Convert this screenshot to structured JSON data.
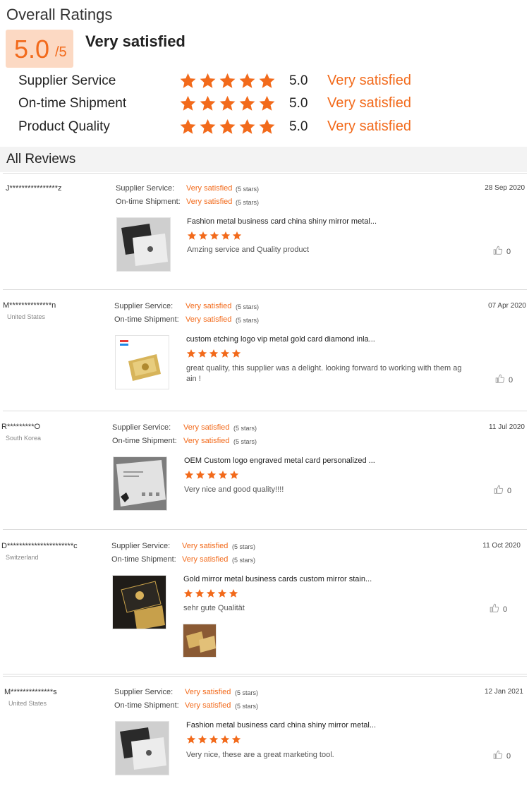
{
  "overall": {
    "title": "Overall Ratings",
    "score_big": "5.0",
    "score_suffix": "/5",
    "label": "Very satisfied",
    "accent": "#f26a1b"
  },
  "criteria": [
    {
      "label": "Supplier Service",
      "stars": 5,
      "score": "5.0",
      "verdict": "Very satisfied"
    },
    {
      "label": "On-time Shipment",
      "stars": 5,
      "score": "5.0",
      "verdict": "Very satisfied"
    },
    {
      "label": "Product Quality",
      "stars": 5,
      "score": "5.0",
      "verdict": "Very satisfied"
    }
  ],
  "all_reviews_title": "All Reviews",
  "reviews": [
    {
      "name": "J****************z",
      "country": "",
      "date": "28 Sep 2020",
      "supplier_service_label": "Supplier Service:",
      "supplier_service_value": "Very satisfied",
      "supplier_service_stars": "(5 stars)",
      "shipment_label": "On-time Shipment:",
      "shipment_value": "Very satisfied",
      "shipment_stars": "(5 stars)",
      "product_title": "Fashion metal business card china shiny mirror metal...",
      "rating": 5,
      "text": "Amzing service and Quality product",
      "likes": "0"
    },
    {
      "name": "M**************n",
      "country": "United States",
      "date": "07 Apr 2020",
      "supplier_service_label": "Supplier Service:",
      "supplier_service_value": "Very satisfied",
      "supplier_service_stars": "(5 stars)",
      "shipment_label": "On-time Shipment:",
      "shipment_value": "Very satisfied",
      "shipment_stars": "(5 stars)",
      "product_title": "custom etching logo vip metal gold card diamond inla...",
      "rating": 5,
      "text": "great quality, this supplier was a delight. looking forward to working with them ag ain !",
      "likes": "0"
    },
    {
      "name": "R*********O",
      "country": "South Korea",
      "date": "11 Jul 2020",
      "supplier_service_label": "Supplier Service:",
      "supplier_service_value": "Very satisfied",
      "supplier_service_stars": "(5 stars)",
      "shipment_label": "On-time Shipment:",
      "shipment_value": "Very satisfied",
      "shipment_stars": "(5 stars)",
      "product_title": "OEM Custom logo engraved metal card personalized ...",
      "rating": 5,
      "text": "Very nice and good quality!!!!",
      "likes": "0"
    },
    {
      "name": "D**********************c",
      "country": "Switzerland",
      "date": "11 Oct 2020",
      "supplier_service_label": "Supplier Service:",
      "supplier_service_value": "Very satisfied",
      "supplier_service_stars": "(5 stars)",
      "shipment_label": "On-time Shipment:",
      "shipment_value": "Very satisfied",
      "shipment_stars": "(5 stars)",
      "product_title": "Gold mirror metal business cards custom mirror stain...",
      "rating": 5,
      "text": "sehr gute Qualität",
      "likes": "0"
    },
    {
      "name": "M**************s",
      "country": "United States",
      "date": "12 Jan 2021",
      "supplier_service_label": "Supplier Service:",
      "supplier_service_value": "Very satisfied",
      "supplier_service_stars": "(5 stars)",
      "shipment_label": "On-time Shipment:",
      "shipment_value": "Very satisfied",
      "shipment_stars": "(5 stars)",
      "product_title": "Fashion metal business card china shiny mirror metal...",
      "rating": 5,
      "text": "Very nice, these are a great marketing tool.",
      "likes": "0"
    }
  ],
  "icons": {
    "star": "star-icon",
    "like": "thumbs-up-icon"
  }
}
